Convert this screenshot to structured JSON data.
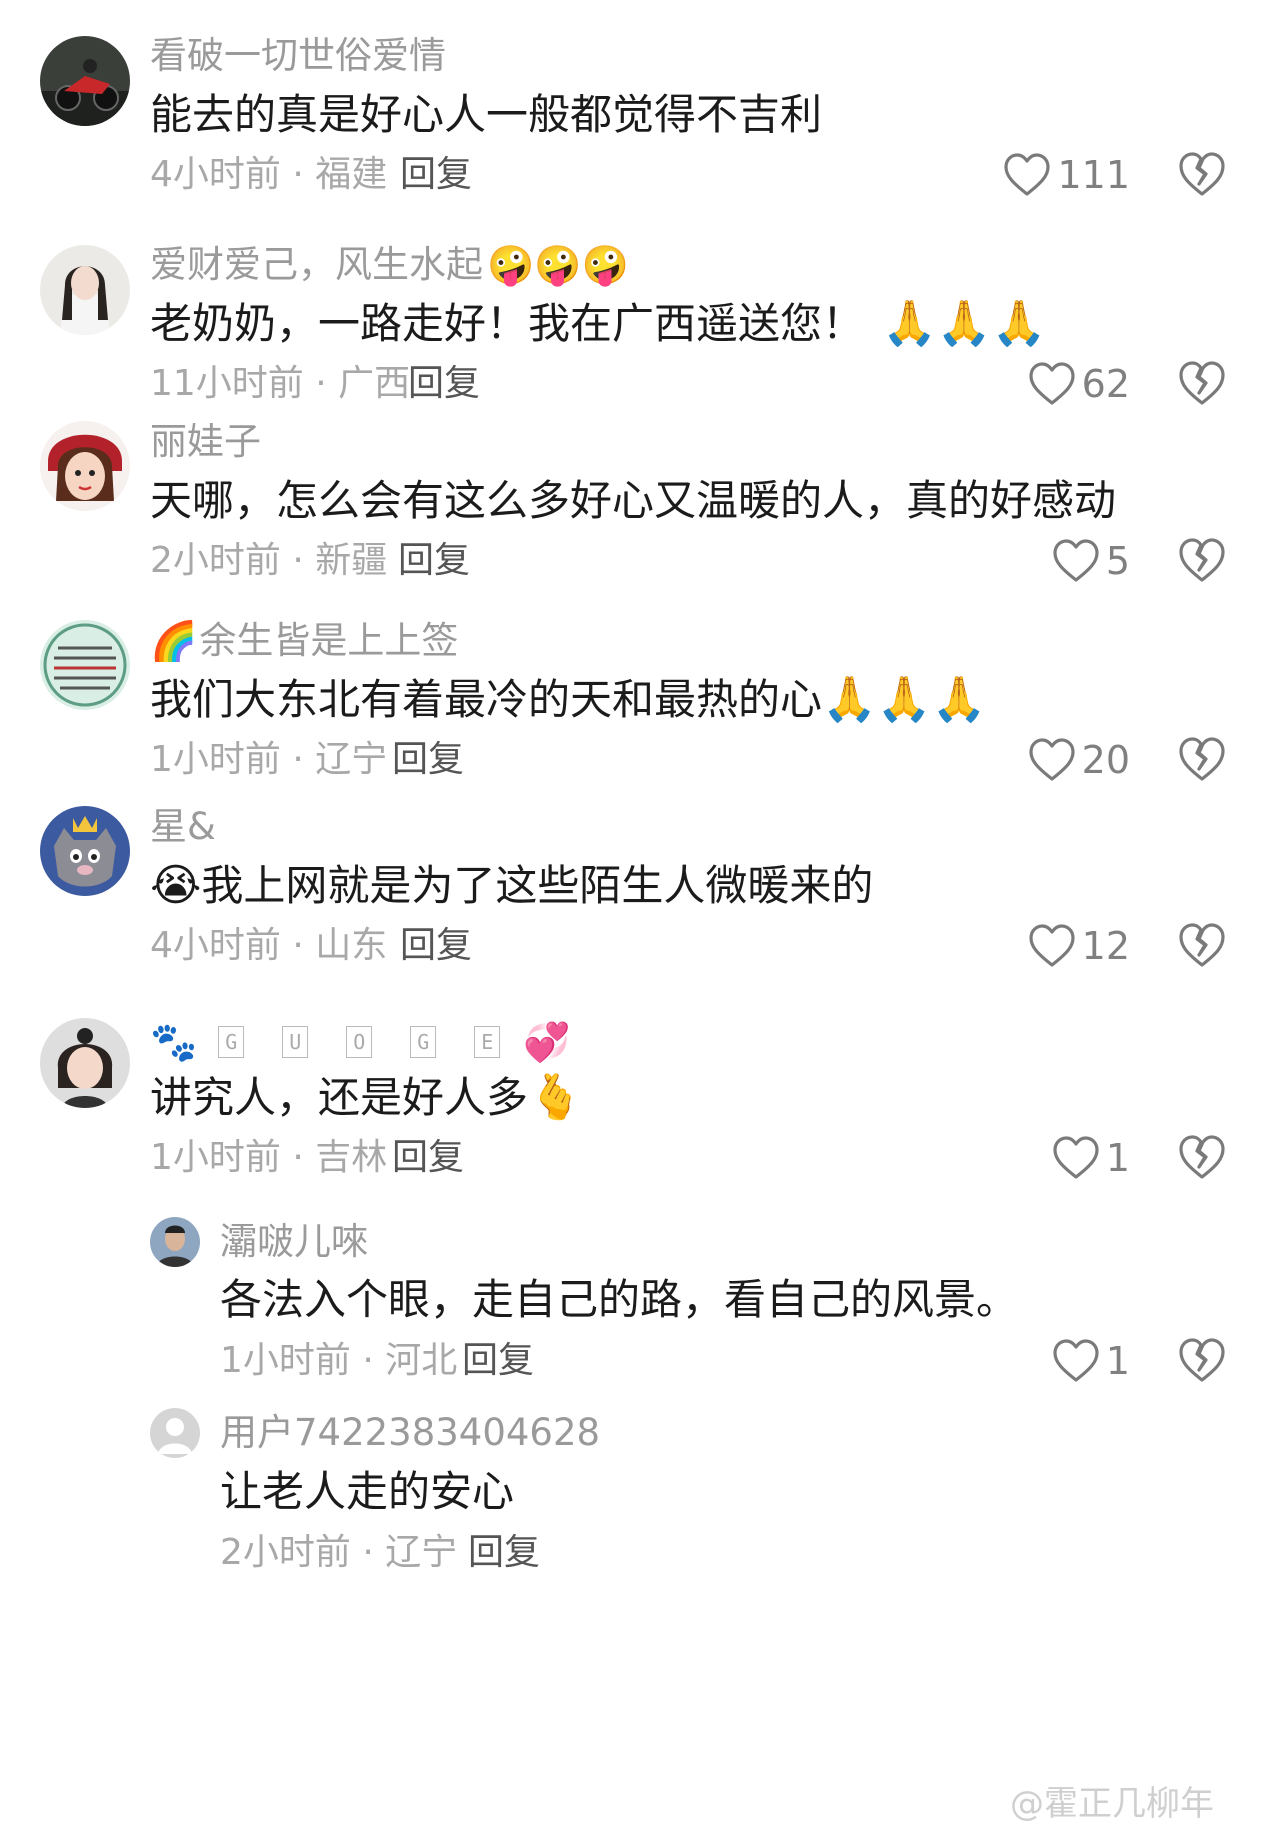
{
  "comments": [
    {
      "username": "看破一切世俗爱情",
      "text": "能去的真是好心人一般都觉得不吉利",
      "time_location": "4小时前 · 福建",
      "reply_label": "回复",
      "likes": "111",
      "avatar_icon": "motorcycle-avatar"
    },
    {
      "username": "爱财爱己，风生水起",
      "username_emoji": "🤪🤪🤪",
      "text": "老奶奶，一路走好！我在广西遥送您！",
      "text_emoji": "🙏🙏🙏",
      "time_location": "11小时前 · 广西",
      "reply_label": "回复",
      "likes": "62",
      "avatar_icon": "woman-portrait-avatar"
    },
    {
      "username": "丽娃子",
      "text": "天哪，怎么会有这么多好心又温暖的人，真的好感动",
      "time_location": "2小时前 · 新疆",
      "reply_label": "回复",
      "likes": "5",
      "avatar_icon": "cartoon-girl-avatar"
    },
    {
      "username_prefix": "🌈",
      "username": "余生皆是上上签",
      "text": "我们大东北有着最冷的天和最热的心",
      "text_emoji": "🙏🙏🙏",
      "time_location": "1小时前 · 辽宁",
      "reply_label": "回复",
      "likes": "20",
      "avatar_icon": "text-card-avatar"
    },
    {
      "username": "星&",
      "text_prefix": "😭",
      "text": "我上网就是为了这些陌生人微暖来的",
      "time_location": "4小时前 · 山东",
      "reply_label": "回复",
      "likes": "12",
      "avatar_icon": "wolf-cartoon-avatar"
    },
    {
      "username_prefix": "🐾",
      "username_letters": [
        "G",
        "U",
        "O",
        "G",
        "E"
      ],
      "username_emoji": "💞",
      "text": "讲究人，还是好人多",
      "text_emoji": "🫰",
      "time_location": "1小时前 · 吉林",
      "reply_label": "回复",
      "likes": "1",
      "avatar_icon": "child-portrait-avatar"
    }
  ],
  "replies": [
    {
      "username": "灞啵儿唻",
      "text": "各法入个眼，走自己的路，看自己的风景。",
      "time_location": "1小时前 · 河北",
      "reply_label": "回复",
      "likes": "1",
      "avatar_icon": "man-photo-avatar"
    },
    {
      "username": "用户7422383404628",
      "text": "让老人走的安心",
      "time_location": "2小时前 · 辽宁",
      "reply_label": "回复",
      "avatar_icon": "default-user-avatar"
    }
  ],
  "watermark": "@霍正几柳年",
  "colors": {
    "muted": "#9a9a9a",
    "text": "#1b1b1b",
    "icon": "#7a7a7a"
  }
}
